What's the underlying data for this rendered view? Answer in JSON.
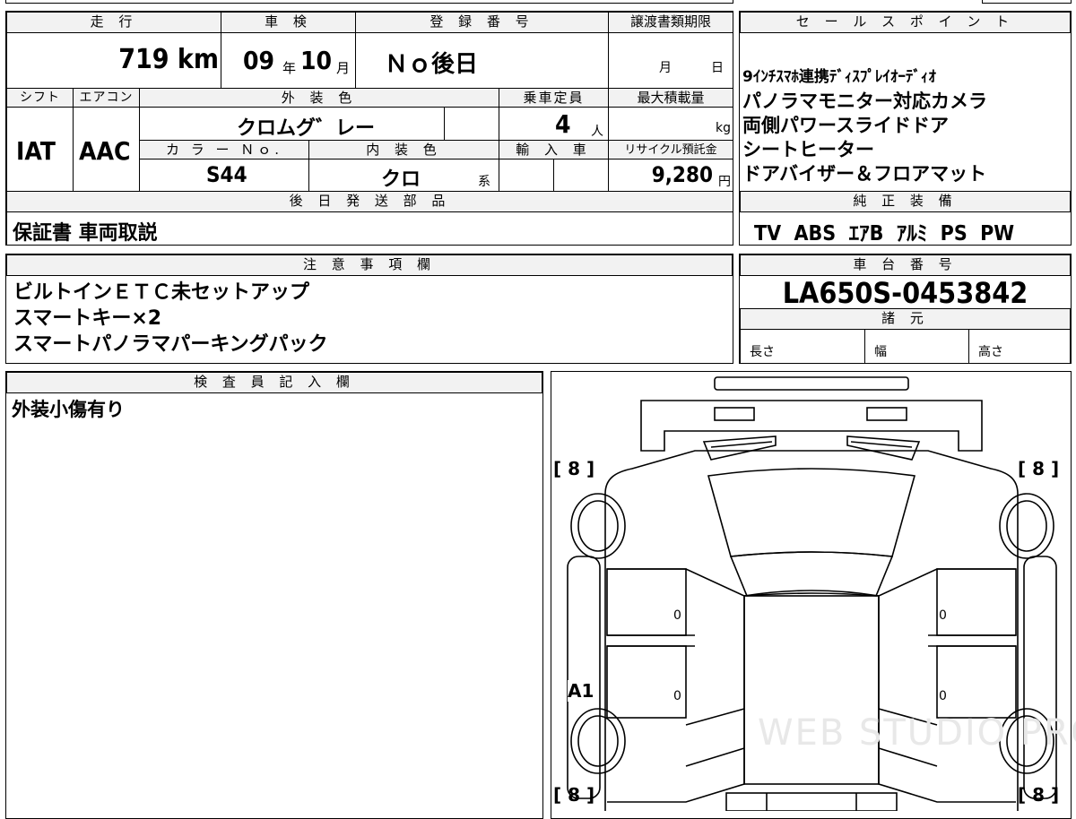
{
  "top": {
    "labels": [
      "走 行",
      "車 検",
      "登 録 番 号",
      "譲渡書類期限"
    ],
    "mileage": "719 km",
    "inspection": {
      "year": "09",
      "year_unit": "年",
      "month": "10",
      "month_unit": "月"
    },
    "registration": "Ｎｏ後日",
    "transfer_deadline": {
      "month": "月",
      "day": "日"
    }
  },
  "row2_labels": {
    "shift": "シフト",
    "aircon": "エアコン",
    "exterior_color": "外 装 色",
    "capacity": "乗車定員",
    "max_load": "最大積載量"
  },
  "shift": "IAT",
  "aircon": "AAC",
  "exterior_color": "クロムグ゛レー",
  "capacity": {
    "value": "4",
    "unit": "人"
  },
  "max_load": {
    "unit": "kg"
  },
  "row3_labels": {
    "color_no": "カ ラ ー Ｎｏ.",
    "interior_color": "内 装 色",
    "import": "輸 入 車",
    "recycle": "リサイクル預託金"
  },
  "color_no": "S44",
  "interior_color": {
    "value": "クロ",
    "suffix": "系"
  },
  "recycle_fee": {
    "value": "9,280",
    "unit": "円"
  },
  "later_parts": {
    "header": "後 日 発 送 部 品",
    "value": "保証書 車両取説"
  },
  "sales_points": {
    "header": "セ ー ル ス ポ イ ン ト",
    "items": [
      "9ｲﾝﾁｽﾏﾎ連携ﾃﾞｨｽﾌﾟﾚｲｵｰﾃﾞｨｵ",
      "パノラマモニター対応カメラ",
      "両側パワースライドドア",
      "シートヒーター",
      "ドアバイザー＆フロアマット"
    ]
  },
  "genuine_equipment": {
    "header": "純 正 装 備",
    "value": "TV  ABS  ｴｱB  ｱﾙﾐ  PS  PW"
  },
  "notes": {
    "header": "注 意 事 項 欄",
    "lines": [
      "ビルトインＥＴＣ未セットアップ",
      "スマートキー×2",
      "スマートパノラマパーキングパック"
    ]
  },
  "chassis": {
    "header": "車 台 番 号",
    "value": "LA650S-0453842"
  },
  "specs": {
    "header": "諸 元",
    "length": "長さ",
    "width": "幅",
    "height": "高さ"
  },
  "inspector": {
    "header": "検 査 員 記 入 欄",
    "value": "外装小傷有り"
  },
  "diagram": {
    "tire_labels": [
      "[ 8 ]",
      "[ 8 ]",
      "[ 8 ]",
      "[ 8 ]"
    ],
    "door_marks": [
      "0",
      "0",
      "0",
      "0"
    ],
    "damage_code": "A1",
    "watermark": "WEB STUDIO PRO"
  }
}
